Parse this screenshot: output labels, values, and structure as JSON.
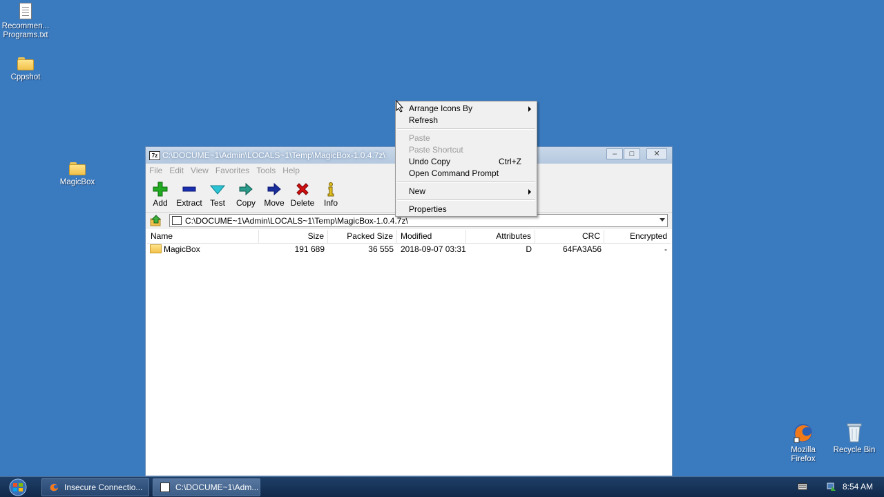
{
  "desktop": {
    "icons": [
      {
        "label_line1": "Recommen...",
        "label_line2": "Programs.txt"
      },
      {
        "label": "Cppshot"
      },
      {
        "label": "MagicBox"
      },
      {
        "label_line1": "Mozilla",
        "label_line2": "Firefox"
      },
      {
        "label": "Recycle Bin"
      }
    ]
  },
  "window": {
    "title": "C:\\DOCUME~1\\Admin\\LOCALS~1\\Temp\\MagicBox-1.0.4.7z\\",
    "app_icon_text": "7z",
    "menu": [
      "File",
      "Edit",
      "View",
      "Favorites",
      "Tools",
      "Help"
    ],
    "toolbar": [
      "Add",
      "Extract",
      "Test",
      "Copy",
      "Move",
      "Delete",
      "Info"
    ],
    "address": "C:\\DOCUME~1\\Admin\\LOCALS~1\\Temp\\MagicBox-1.0.4.7z\\",
    "columns": [
      "Name",
      "Size",
      "Packed Size",
      "Modified",
      "Attributes",
      "CRC",
      "Encrypted"
    ],
    "rows": [
      {
        "name": "MagicBox",
        "size": "191 689",
        "packed": "36 555",
        "modified": "2018-09-07 03:31",
        "attributes": "D",
        "crc": "64FA3A56",
        "encrypted": "-"
      }
    ]
  },
  "context_menu": {
    "items": [
      {
        "label": "Arrange Icons By",
        "submenu": true
      },
      {
        "label": "Refresh"
      },
      {
        "label": "Paste",
        "disabled": true
      },
      {
        "label": "Paste Shortcut",
        "disabled": true
      },
      {
        "label": "Undo Copy",
        "shortcut": "Ctrl+Z"
      },
      {
        "label": "Open Command Prompt"
      },
      {
        "label": "New",
        "submenu": true
      },
      {
        "label": "Properties"
      }
    ]
  },
  "taskbar": {
    "tasks": [
      {
        "label": "Insecure Connectio..."
      },
      {
        "label": "C:\\DOCUME~1\\Adm..."
      }
    ],
    "clock": "8:54 AM"
  },
  "colors": {
    "desktop": "#3a7abf",
    "taskbar": "#12294a",
    "add_icon": "#22aa22",
    "delete_icon": "#d01010"
  }
}
